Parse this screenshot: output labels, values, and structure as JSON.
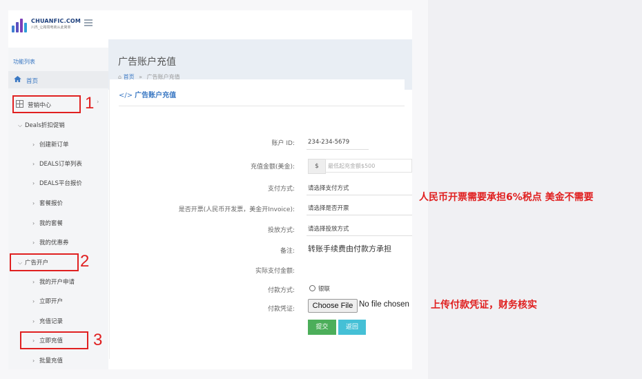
{
  "brand": {
    "name": "CHUANFIC.COM",
    "tagline": "川杰_让跨境电商从此简单"
  },
  "sidebar": {
    "heading": "功能列表",
    "home": "首页",
    "marketing": "营销中心",
    "deals_group": "Deals折扣促销",
    "deals_items": [
      "创建新订单",
      "DEALS订单列表",
      "DEALS平台报价",
      "套餐报价",
      "我的套餐",
      "我的优惠券"
    ],
    "ad_group": "广告开户",
    "ad_items": [
      "我的开户申请",
      "立即开户",
      "充值记录",
      "立即充值",
      "批量充值"
    ]
  },
  "page": {
    "title": "广告账户充值",
    "breadcrumb_home": "首页",
    "breadcrumb_sep": "»",
    "breadcrumb_current": "广告账户充值"
  },
  "panel": {
    "title": "广告账户充值",
    "title_icon": "</>"
  },
  "form": {
    "account_label": "账户 ID:",
    "account_value": "234-234-5679",
    "amount_label": "充值金额(美金):",
    "currency_symbol": "$",
    "amount_placeholder": "最低起充金额$500",
    "pay_method_label": "支付方式:",
    "pay_method_value": "请选择支付方式",
    "invoice_label": "是否开票(人民币开发票，美金开Invoice):",
    "invoice_value": "请选择是否开票",
    "delivery_label": "投放方式:",
    "delivery_value": "请选择投放方式",
    "remark_label": "备注:",
    "remark_value": "转账手续费由付款方承担",
    "actual_label": "实际支付金额:",
    "payment_label": "付款方式:",
    "payment_option": "银联",
    "voucher_label": "付款凭证:",
    "file_button": "Choose File",
    "file_status": "No file chosen",
    "submit": "提交",
    "back": "返回"
  },
  "annotations": {
    "num1": "1",
    "num2": "2",
    "num3": "3",
    "note_tax": "人民币开票需要承担6%税点 美金不需要",
    "note_upload": "上传付款凭证，财务核实",
    "color": "#e02020"
  },
  "colors": {
    "accent": "#3a78c3",
    "submit": "#4cae5a",
    "back": "#45c0d6"
  }
}
